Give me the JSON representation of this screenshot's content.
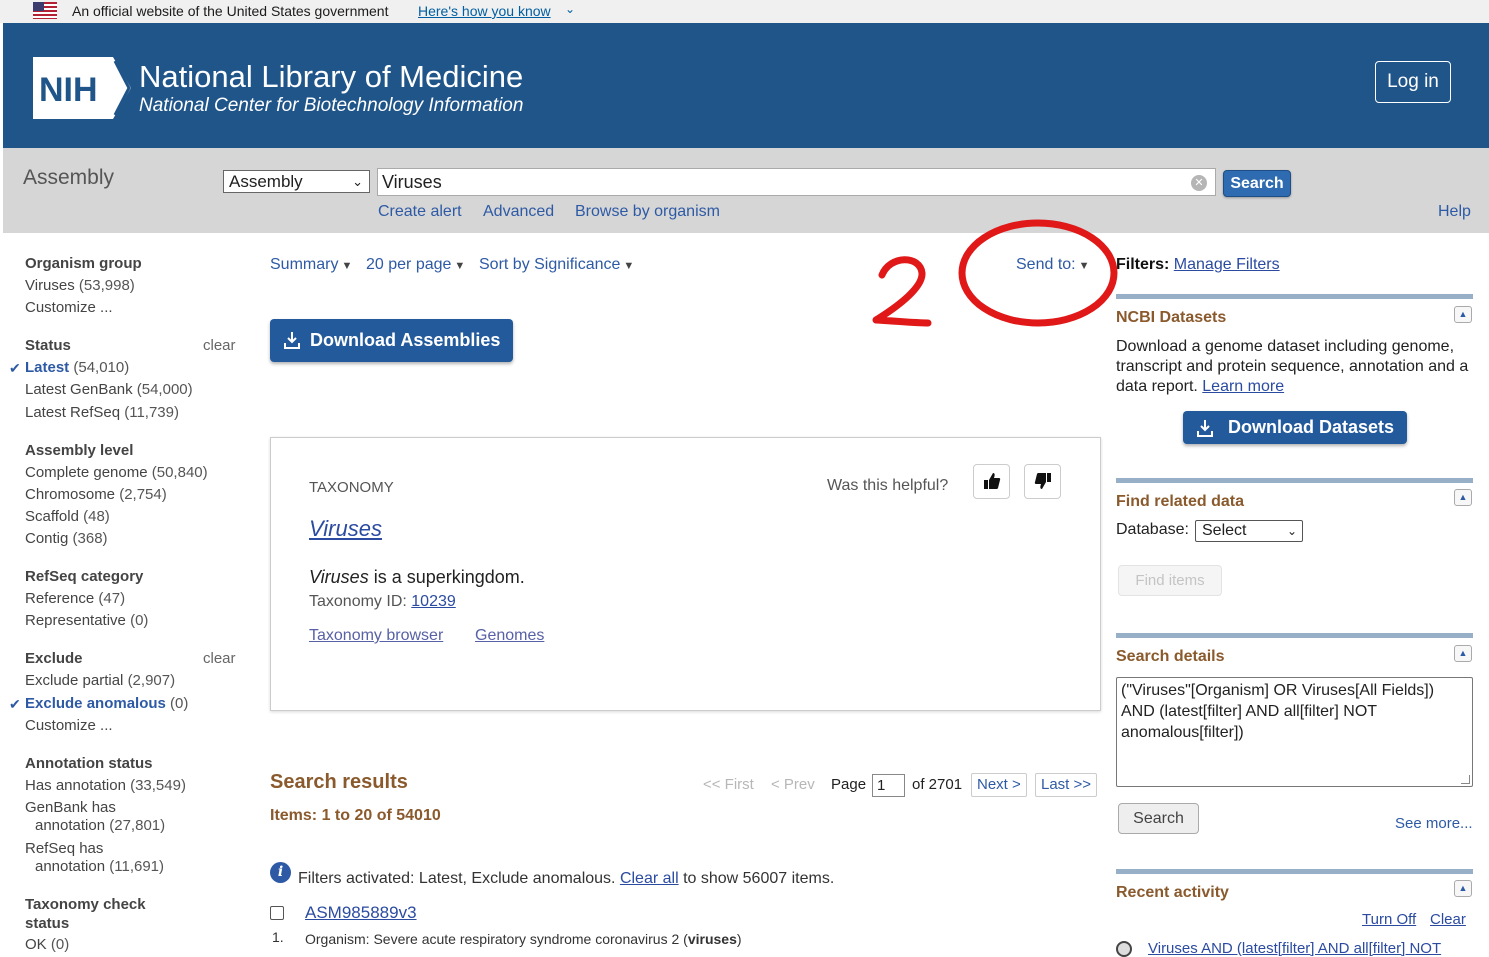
{
  "gov_banner": {
    "text": "An official website of the United States government",
    "link": "Here's how you know"
  },
  "header": {
    "logo_text": "NIH",
    "title": "National Library of Medicine",
    "subtitle": "National Center for Biotechnology Information",
    "login_label": "Log in"
  },
  "search": {
    "db_title": "Assembly",
    "db_selected": "Assembly",
    "term": "Viruses",
    "button_label": "Search",
    "links": [
      "Create alert",
      "Advanced",
      "Browse by organism"
    ],
    "help": "Help"
  },
  "facets": {
    "organism_group": {
      "title": "Organism group",
      "items": [
        {
          "label": "Viruses",
          "count": "(53,998)"
        },
        {
          "label": "Customize ..."
        }
      ]
    },
    "status": {
      "title": "Status",
      "clear": "clear",
      "items": [
        {
          "label": "Latest",
          "count": "(54,010)",
          "active": true
        },
        {
          "label": "Latest GenBank",
          "count": "(54,000)"
        },
        {
          "label": "Latest RefSeq",
          "count": "(11,739)"
        }
      ]
    },
    "assembly_level": {
      "title": "Assembly level",
      "items": [
        {
          "label": "Complete genome",
          "count": "(50,840)"
        },
        {
          "label": "Chromosome",
          "count": "(2,754)"
        },
        {
          "label": "Scaffold",
          "count": "(48)"
        },
        {
          "label": "Contig",
          "count": "(368)"
        }
      ]
    },
    "refseq_category": {
      "title": "RefSeq category",
      "items": [
        {
          "label": "Reference",
          "count": "(47)"
        },
        {
          "label": "Representative",
          "count": "(0)"
        }
      ]
    },
    "exclude": {
      "title": "Exclude",
      "clear": "clear",
      "items": [
        {
          "label": "Exclude partial",
          "count": "(2,907)"
        },
        {
          "label": "Exclude anomalous",
          "count": "(0)",
          "active": true
        },
        {
          "label": "Customize ..."
        }
      ]
    },
    "annotation_status": {
      "title": "Annotation status",
      "items": [
        {
          "label": "Has annotation",
          "count": "(33,549)"
        },
        {
          "label": "GenBank has",
          "label2": "annotation",
          "count": "(27,801)"
        },
        {
          "label": "RefSeq has",
          "label2": "annotation",
          "count": "(11,691)"
        }
      ]
    },
    "taxonomy_check": {
      "title": "Taxonomy check",
      "title2": "status",
      "items": [
        {
          "label": "OK",
          "count": "(0)"
        }
      ]
    }
  },
  "toolbar": {
    "summary": "Summary",
    "per_page": "20 per page",
    "sort": "Sort by Significance",
    "send_to": "Send to:",
    "download_assemblies": "Download Assemblies"
  },
  "taxonomy_card": {
    "label": "TAXONOMY",
    "helpful": "Was this helpful?",
    "name": "Viruses",
    "desc_name": "Viruses",
    "desc_rest": " is a superkingdom.",
    "id_label": "Taxonomy ID: ",
    "id_value": "10239",
    "link_browser": "Taxonomy browser",
    "link_genomes": "Genomes"
  },
  "results": {
    "title": "Search results",
    "items": "Items: 1 to 20 of 54010",
    "first": "<< First",
    "prev": "< Prev",
    "page_label": "Page",
    "page_value": "1",
    "of_pages": "of 2701",
    "next": "Next >",
    "last": "Last >>",
    "filters_text": "Filters activated: Latest, Exclude anomalous. ",
    "clear_all": "Clear all",
    "filters_tail": " to show 56007 items.",
    "first_row": {
      "title": "ASM985889v3",
      "number": "1.",
      "organism_prefix": "Organism: Severe acute respiratory syndrome coronavirus 2 (",
      "organism_bold": "viruses",
      "organism_suffix": ")"
    }
  },
  "right": {
    "filters_label": "Filters:",
    "manage_filters": "Manage Filters",
    "ncbi_datasets": {
      "title": "NCBI Datasets",
      "text": "Download a genome dataset including genome, transcript and protein sequence, annotation and a data report. ",
      "learn_more": "Learn more",
      "button": "Download Datasets"
    },
    "find_related": {
      "title": "Find related data",
      "db_label": "Database:",
      "db_selected": "Select",
      "button": "Find items"
    },
    "search_details": {
      "title": "Search details",
      "query": "(\"Viruses\"[Organism] OR Viruses[All Fields]) AND (latest[filter] AND all[filter] NOT anomalous[filter])",
      "button": "Search",
      "see_more": "See more..."
    },
    "recent_activity": {
      "title": "Recent activity",
      "turn_off": "Turn Off",
      "clear": "Clear",
      "item": "Viruses AND (latest[filter] AND all[filter] NOT"
    }
  },
  "annotation": {
    "number": "2",
    "color": "#e01818"
  },
  "colors": {
    "header_bg": "#20558a",
    "search_bar_bg": "#d6d6d6",
    "section_title": "#8a5a2d",
    "link": "#2b4ba1",
    "primary_button": "#235a9c"
  }
}
